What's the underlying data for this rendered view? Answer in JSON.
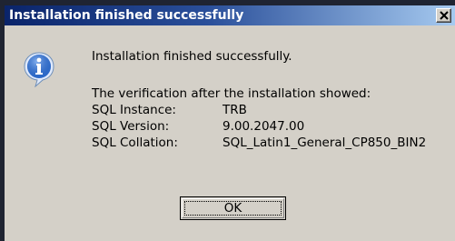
{
  "dialog": {
    "title": "Installation finished successfully",
    "message": "Installation finished successfully.",
    "verification_intro": "The verification after the installation showed:",
    "rows": [
      {
        "label": "SQL Instance:",
        "value": "TRB"
      },
      {
        "label": "SQL Version:",
        "value": "9.00.2047.00"
      },
      {
        "label": "SQL Collation:",
        "value": "SQL_Latin1_General_CP850_BIN2"
      }
    ],
    "ok_label": "OK",
    "icon": "info-icon"
  },
  "colors": {
    "title_bar_start": "#0a246a",
    "title_bar_end": "#a6caf0",
    "dialog_face": "#d4d0c8",
    "icon_blue": "#2f6fd0"
  }
}
